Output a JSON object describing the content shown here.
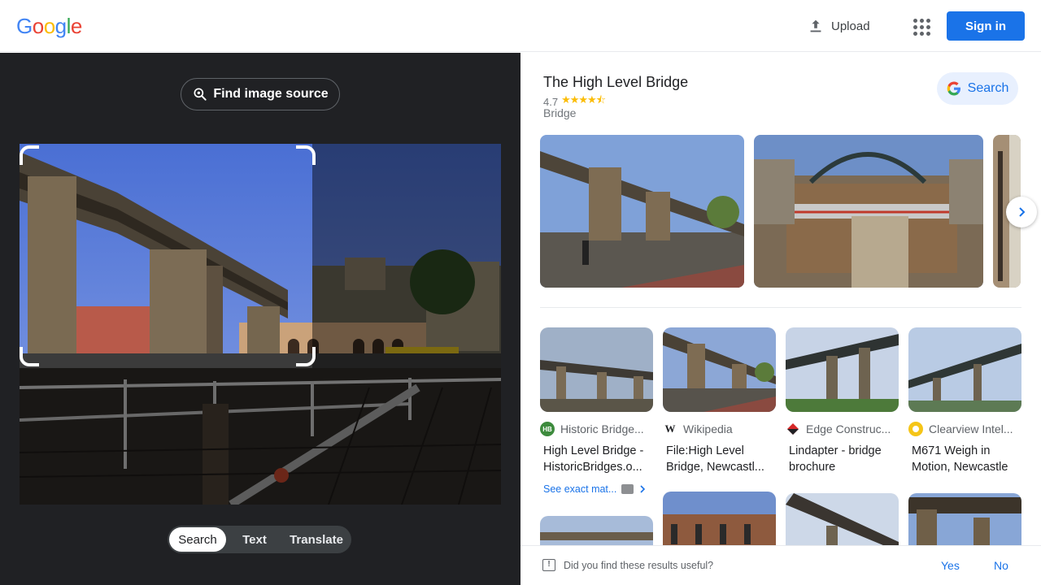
{
  "header": {
    "logo_letters": [
      {
        "ch": "G",
        "color": "#4285f4"
      },
      {
        "ch": "o",
        "color": "#ea4335"
      },
      {
        "ch": "o",
        "color": "#fbbc05"
      },
      {
        "ch": "g",
        "color": "#4285f4"
      },
      {
        "ch": "l",
        "color": "#34a853"
      },
      {
        "ch": "e",
        "color": "#ea4335"
      }
    ],
    "upload_label": "Upload",
    "apps_icon": "apps-grid-icon",
    "signin_label": "Sign in"
  },
  "left": {
    "find_source_label": "Find image source",
    "modes": [
      "Search",
      "Text",
      "Translate"
    ],
    "active_mode": "Search"
  },
  "knowledge": {
    "title": "The High Level Bridge",
    "rating": "4.7",
    "stars": 4.7,
    "kind": "Bridge",
    "search_label": "Search"
  },
  "results": [
    {
      "source": "Historic Bridge...",
      "source_icon": "HB",
      "title_lines": [
        "High Level Bridge -",
        "HistoricBridges.o..."
      ],
      "exact": "See exact mat..."
    },
    {
      "source": "Wikipedia",
      "source_icon": "W",
      "title_lines": [
        "File:High Level",
        "Bridge, Newcastl..."
      ]
    },
    {
      "source": "Edge Construc...",
      "source_icon": "edge",
      "title_lines": [
        "Lindapter - bridge",
        "brochure"
      ]
    },
    {
      "source": "Clearview Intel...",
      "source_icon": "clearview",
      "title_lines": [
        "M671 Weigh in",
        "Motion, Newcastle"
      ]
    }
  ],
  "footer": {
    "question": "Did you find these results useful?",
    "yes": "Yes",
    "no": "No"
  },
  "colors": {
    "accent": "#1a73e8",
    "dark_panel": "#202124",
    "star": "#fbbc04"
  }
}
